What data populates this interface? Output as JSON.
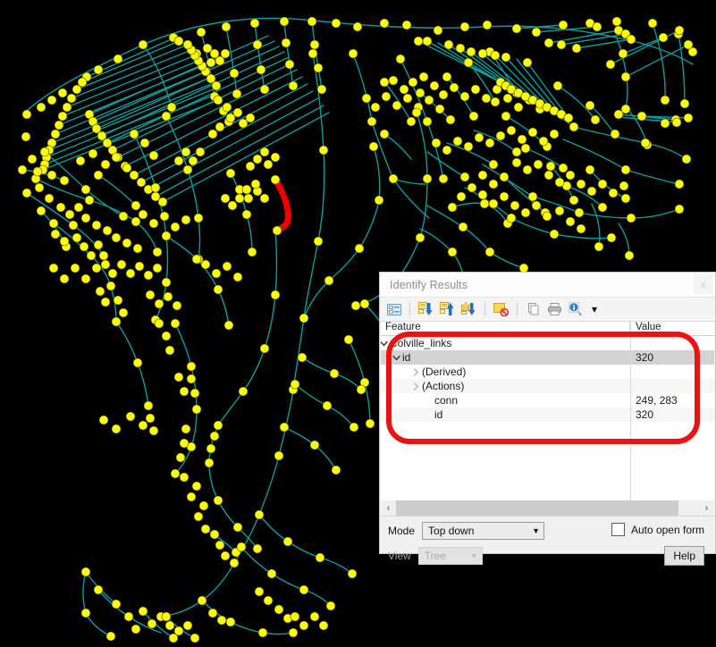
{
  "panel": {
    "title": "Identify Results",
    "close_label": "x",
    "toolbar": {
      "icons": [
        {
          "name": "expand-all-icon",
          "label": "Expand all"
        },
        {
          "name": "collapse-down-icon",
          "label": "Collapse"
        },
        {
          "name": "expand-up-icon",
          "label": "Expand"
        },
        {
          "name": "highlight-feature-icon",
          "label": "Highlight"
        },
        {
          "name": "clear-results-icon",
          "label": "Clear results"
        },
        {
          "name": "copy-icon",
          "label": "Copy"
        },
        {
          "name": "print-icon",
          "label": "Print"
        },
        {
          "name": "identify-settings-icon",
          "label": "Identify settings"
        }
      ],
      "dropdown_caret": "▾"
    },
    "columns": [
      "Feature",
      "Value"
    ],
    "tree": [
      {
        "label": "Colville_links",
        "value": "",
        "indent": 0,
        "twisty": "down",
        "selected": false,
        "alt": false
      },
      {
        "label": "id",
        "value": "320",
        "indent": 1,
        "twisty": "down",
        "selected": true,
        "alt": false
      },
      {
        "label": "(Derived)",
        "value": "",
        "indent": 2,
        "twisty": "right",
        "selected": false,
        "alt": false
      },
      {
        "label": "(Actions)",
        "value": "",
        "indent": 2,
        "twisty": "right",
        "selected": false,
        "alt": true
      },
      {
        "label": "conn",
        "value": "249, 283",
        "indent": 3,
        "twisty": "none",
        "selected": false,
        "alt": false
      },
      {
        "label": "id",
        "value": "320",
        "indent": 3,
        "twisty": "none",
        "selected": false,
        "alt": true
      }
    ],
    "scroll": {
      "left_arrow": "‹",
      "right_arrow": "›"
    },
    "controls": {
      "mode_label": "Mode",
      "mode_value": "Top down",
      "view_label": "View",
      "view_value": "Tree",
      "auto_open_label": "Auto open form",
      "auto_open_checked": false,
      "help_label": "Help"
    }
  },
  "map": {
    "background_color": "#000000",
    "node_color": "#ffff00",
    "node_outline_color": "#3a3a00",
    "line_color": "#0f9c9c",
    "selected_line_color": "#ee0000",
    "layer_name": "Colville_links",
    "selected_feature_id": "320"
  },
  "annotation": {
    "shape": "rounded-rectangle",
    "color": "#ee1111"
  }
}
